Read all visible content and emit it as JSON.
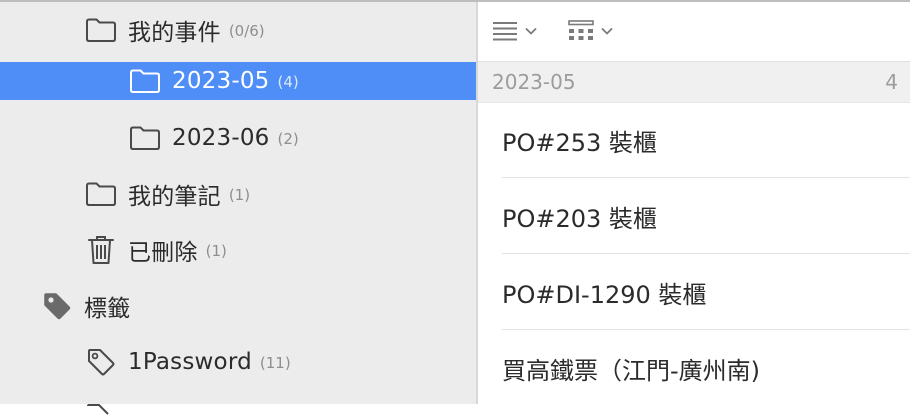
{
  "sidebar": {
    "items": [
      {
        "label": "我的事件",
        "count": "(0/6)",
        "icon": "folder-icon"
      },
      {
        "label": "2023-05",
        "count": "(4)",
        "icon": "folder-icon",
        "selected": true
      },
      {
        "label": "2023-06",
        "count": "(2)",
        "icon": "folder-icon"
      },
      {
        "label": "我的筆記",
        "count": "(1)",
        "icon": "folder-icon"
      },
      {
        "label": "已刪除",
        "count": "(1)",
        "icon": "trash-icon"
      },
      {
        "label": "標籤",
        "icon": "tag-icon"
      },
      {
        "label": "1Password",
        "count": "(11)",
        "icon": "tag-icon"
      }
    ]
  },
  "toolbar": {
    "view_menu_icon": "list-view-icon",
    "grid_menu_icon": "grid-view-icon"
  },
  "list": {
    "group": {
      "title": "2023-05",
      "count": "4"
    },
    "items": [
      {
        "title": "PO#253 裝櫃"
      },
      {
        "title": "PO#203 裝櫃"
      },
      {
        "title": "PO#DI-1290 裝櫃"
      },
      {
        "title": "買高鐵票（江門-廣州南)"
      }
    ]
  },
  "colors": {
    "selection": "#4f8ef7",
    "sidebar_bg": "#ececec",
    "count_text": "#8e8e8e",
    "group_header_bg": "#f0f0f0"
  }
}
